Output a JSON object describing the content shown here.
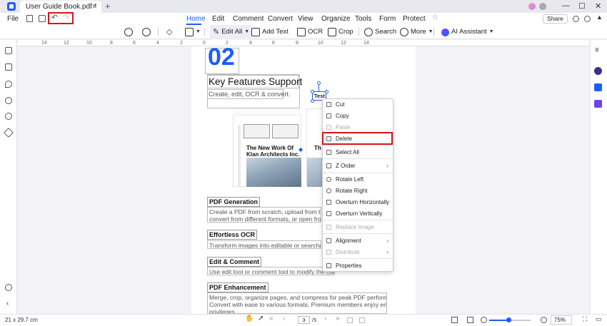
{
  "titlebar": {
    "tab_title": "User Guide Book.pdf *",
    "close": "✕",
    "new_tab": "+",
    "minimize": "—",
    "maximize": "☐",
    "close_window": "✕"
  },
  "menu": {
    "file": "File",
    "items": [
      "Home",
      "Edit",
      "Comment",
      "Convert",
      "View",
      "Organize",
      "Tools",
      "Form",
      "Protect"
    ],
    "active": "Home",
    "share": "Share"
  },
  "toolbar": {
    "edit_all": "Edit All",
    "add_text": "Add Text",
    "ocr": "OCR",
    "crop": "Crop",
    "search": "Search",
    "more": "More",
    "ai_assistant": "AI Assistant"
  },
  "ruler": [
    "14",
    "12",
    "10",
    "8",
    "6",
    "4",
    "2",
    "0",
    "2",
    "4",
    "6",
    "8",
    "10",
    "12",
    "14"
  ],
  "page": {
    "number": "02",
    "heading": "Key Features Support",
    "subheading": "Create, edit, OCR & convert.",
    "thumbnail_title": "The New Work Of Klan Architects Inc.",
    "thumbnail_title2": "Th Kl",
    "selected_text": "Test",
    "sections": [
      {
        "title": "PDF Generation",
        "text": [
          "Create a PDF from scratch, upload from the Te",
          "convert from different formats, or open from yo"
        ]
      },
      {
        "title": "Effortless OCR",
        "text": [
          "Transform images into editable or searchable te"
        ]
      },
      {
        "title": "Edit & Comment",
        "text": [
          "Use edit tool or comment tool to modify the cont"
        ]
      },
      {
        "title": "PDF Enhancement",
        "text": [
          "Merge, crop, organize pages, and compress for peak PDF performance.",
          "Convert with ease to various formats. Premium members enjoy enhanced",
          "privileges."
        ]
      }
    ]
  },
  "context_menu": {
    "items": [
      {
        "label": "Cut",
        "disabled": false
      },
      {
        "label": "Copy",
        "disabled": false
      },
      {
        "label": "Paste",
        "disabled": true
      },
      {
        "label": "Delete",
        "disabled": false,
        "highlighted": true
      },
      {
        "label": "Select All",
        "disabled": false
      },
      {
        "label": "Z Order",
        "disabled": false,
        "submenu": true
      },
      {
        "label": "Rotate Left",
        "disabled": false
      },
      {
        "label": "Rotate Right",
        "disabled": false
      },
      {
        "label": "Overturn Horizontally",
        "disabled": false
      },
      {
        "label": "Overturn Vertically",
        "disabled": false
      },
      {
        "label": "Replace Image",
        "disabled": true
      },
      {
        "label": "Alignment",
        "disabled": false,
        "submenu": true
      },
      {
        "label": "Distribute",
        "disabled": true,
        "submenu": true
      },
      {
        "label": "Properties",
        "disabled": false
      }
    ]
  },
  "statusbar": {
    "page_size": "21 x 29.7 cm",
    "page_current": "3",
    "page_total": "/5",
    "zoom": "75%",
    "zoom_level": 0.47
  },
  "colors": {
    "accent": "#1a5cff",
    "highlight": "#d8141d"
  }
}
